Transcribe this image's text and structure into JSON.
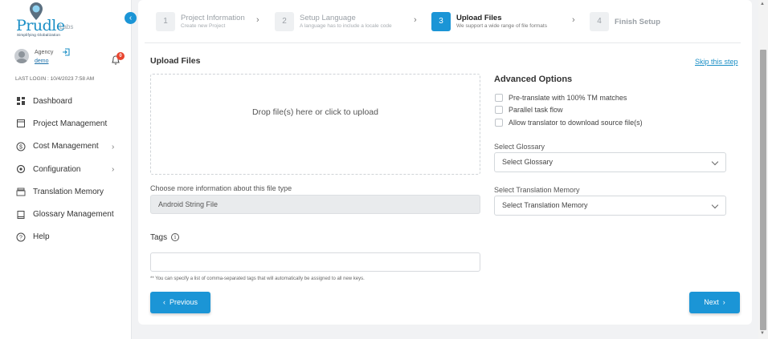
{
  "sidebar": {
    "logo": {
      "word": "Prudle",
      "suffix": "Labs",
      "tagline": "Simplifying Globalization"
    },
    "user": {
      "role": "Agency",
      "name": "demo",
      "notifications": "0"
    },
    "last_login": "LAST LOGIN : 10/4/2023 7:58 AM",
    "items": [
      {
        "label": "Dashboard",
        "icon": "dashboard-icon",
        "has_submenu": false
      },
      {
        "label": "Project Management",
        "icon": "project-icon",
        "has_submenu": false
      },
      {
        "label": "Cost Management",
        "icon": "dollar-icon",
        "has_submenu": true
      },
      {
        "label": "Configuration",
        "icon": "settings-icon",
        "has_submenu": true
      },
      {
        "label": "Translation Memory",
        "icon": "stack-icon",
        "has_submenu": false
      },
      {
        "label": "Glossary Management",
        "icon": "book-icon",
        "has_submenu": false
      },
      {
        "label": "Help",
        "icon": "help-icon",
        "has_submenu": false
      }
    ]
  },
  "stepper": {
    "steps": [
      {
        "number": "1",
        "title": "Project Information",
        "subtitle": "Create new Project"
      },
      {
        "number": "2",
        "title": "Setup Language",
        "subtitle": "A language has to include a locale code"
      },
      {
        "number": "3",
        "title": "Upload Files",
        "subtitle": "We support a wide range of file formats"
      },
      {
        "number": "4",
        "title": "Finish Setup",
        "subtitle": ""
      }
    ],
    "active_step": 3
  },
  "upload": {
    "title": "Upload Files",
    "skip_label": "Skip this step",
    "dropzone_text": "Drop file(s) here or click to upload",
    "file_type_label": "Choose more information about this file type",
    "file_type_value": "Android String File",
    "tags_label": "Tags",
    "tags_value": "",
    "tags_note": "** You can specify a list of comma-separated tags that will automatically be assigned to all new keys."
  },
  "advanced": {
    "title": "Advanced Options",
    "options": [
      {
        "label": "Pre-translate with 100% TM matches",
        "checked": false
      },
      {
        "label": "Parallel task flow",
        "checked": false
      },
      {
        "label": "Allow translator to download source file(s)",
        "checked": false
      }
    ],
    "glossary_label": "Select Glossary",
    "glossary_value": "Select Glossary",
    "tm_label": "Select Translation Memory",
    "tm_value": "Select Translation Memory"
  },
  "actions": {
    "previous": "Previous",
    "next": "Next"
  },
  "colors": {
    "accent": "#1b95d6",
    "badge": "#e8442e"
  }
}
